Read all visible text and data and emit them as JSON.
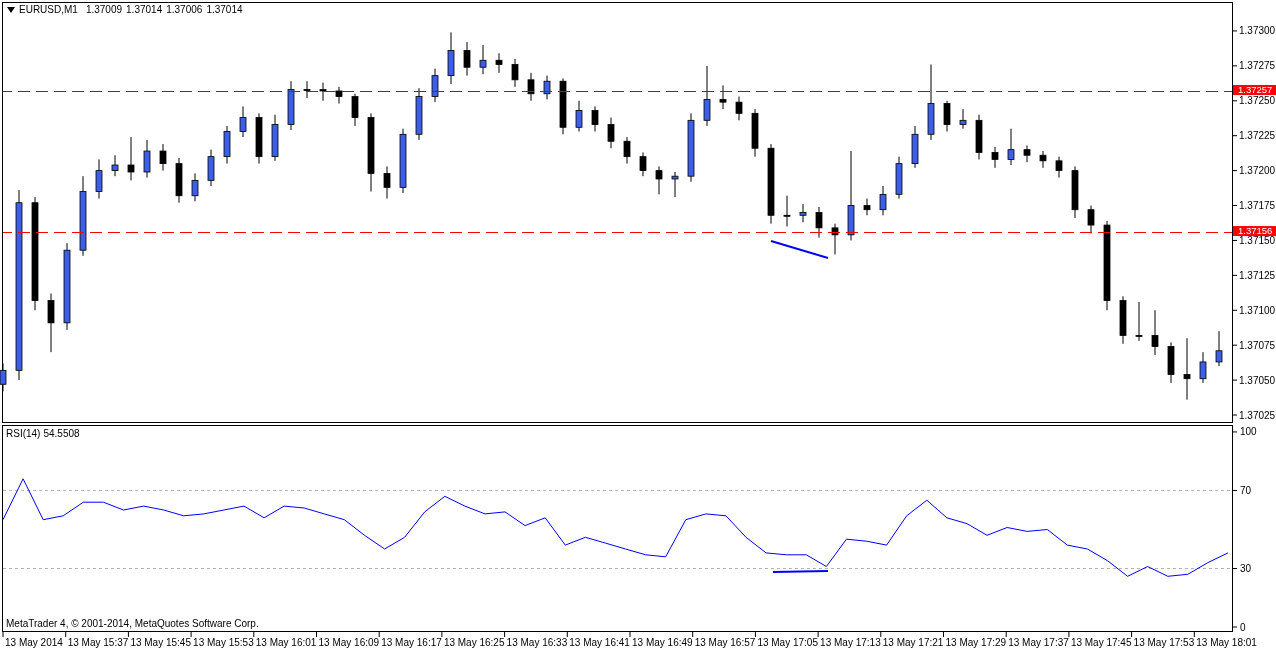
{
  "chart_header": {
    "symbol": "EURUSD,M1",
    "quotes": [
      "1.37009",
      "1.37014",
      "1.37006",
      "1.37014"
    ]
  },
  "horizontal_lines": [
    {
      "label": "1.37257",
      "color": "#404040"
    },
    {
      "label": "1.37156",
      "color": "#ff0000"
    }
  ],
  "price_chart": {
    "chart_data": {
      "type": "candlestick",
      "ylim": [
        1.3702,
        1.3732
      ],
      "yticks": [
        {
          "value": 1.373,
          "label": "1.37300"
        },
        {
          "value": 1.37275,
          "label": "1.37275"
        },
        {
          "value": 1.3725,
          "label": "1.37250"
        },
        {
          "value": 1.37225,
          "label": "1.37225"
        },
        {
          "value": 1.372,
          "label": "1.37200"
        },
        {
          "value": 1.37175,
          "label": "1.37175"
        },
        {
          "value": 1.3715,
          "label": "1.37150"
        },
        {
          "value": 1.37125,
          "label": "1.37125"
        },
        {
          "value": 1.371,
          "label": "1.37100"
        },
        {
          "value": 1.37075,
          "label": "1.37075"
        },
        {
          "value": 1.3705,
          "label": "1.37050"
        },
        {
          "value": 1.37025,
          "label": "1.37025"
        }
      ],
      "ohlc": [
        [
          1.37047,
          1.37062,
          1.37042,
          1.37057
        ],
        [
          1.37057,
          1.37186,
          1.3705,
          1.37177
        ],
        [
          1.37177,
          1.37181,
          1.371,
          1.37107
        ],
        [
          1.37107,
          1.37112,
          1.3707,
          1.37091
        ],
        [
          1.37091,
          1.37148,
          1.37086,
          1.37143
        ],
        [
          1.37143,
          1.37196,
          1.37139,
          1.37185
        ],
        [
          1.37185,
          1.37208,
          1.3718,
          1.372
        ],
        [
          1.372,
          1.37211,
          1.37196,
          1.37204
        ],
        [
          1.37204,
          1.37224,
          1.37193,
          1.37199
        ],
        [
          1.37199,
          1.37222,
          1.37195,
          1.37214
        ],
        [
          1.37214,
          1.37219,
          1.372,
          1.37205
        ],
        [
          1.37205,
          1.37209,
          1.37177,
          1.37182
        ],
        [
          1.37182,
          1.37198,
          1.37178,
          1.37193
        ],
        [
          1.37193,
          1.37215,
          1.37189,
          1.3721
        ],
        [
          1.3721,
          1.37232,
          1.37205,
          1.37228
        ],
        [
          1.37228,
          1.37246,
          1.37224,
          1.37238
        ],
        [
          1.37238,
          1.37241,
          1.37205,
          1.3721
        ],
        [
          1.3721,
          1.3724,
          1.37207,
          1.37233
        ],
        [
          1.37233,
          1.37264,
          1.37229,
          1.37258
        ],
        [
          1.37258,
          1.37264,
          1.37252,
          1.37258
        ],
        [
          1.37258,
          1.37263,
          1.3725,
          1.37257
        ],
        [
          1.37257,
          1.3726,
          1.37248,
          1.37253
        ],
        [
          1.37253,
          1.37255,
          1.37232,
          1.37238
        ],
        [
          1.37238,
          1.37241,
          1.37185,
          1.37198
        ],
        [
          1.37198,
          1.37203,
          1.3718,
          1.37188
        ],
        [
          1.37188,
          1.3723,
          1.37184,
          1.37226
        ],
        [
          1.37226,
          1.37259,
          1.37222,
          1.37253
        ],
        [
          1.37253,
          1.37273,
          1.37249,
          1.37268
        ],
        [
          1.37268,
          1.37299,
          1.37262,
          1.37286
        ],
        [
          1.37286,
          1.37292,
          1.37268,
          1.37274
        ],
        [
          1.37274,
          1.3729,
          1.37269,
          1.37279
        ],
        [
          1.37279,
          1.37284,
          1.3727,
          1.37276
        ],
        [
          1.37276,
          1.3728,
          1.3726,
          1.37265
        ],
        [
          1.37265,
          1.3727,
          1.3725,
          1.37255
        ],
        [
          1.37255,
          1.37268,
          1.37251,
          1.37264
        ],
        [
          1.37264,
          1.37266,
          1.37226,
          1.37231
        ],
        [
          1.37231,
          1.3725,
          1.37228,
          1.37243
        ],
        [
          1.37243,
          1.37246,
          1.37228,
          1.37233
        ],
        [
          1.37233,
          1.37238,
          1.37216,
          1.37221
        ],
        [
          1.37221,
          1.37224,
          1.37205,
          1.3721
        ],
        [
          1.3721,
          1.37213,
          1.37196,
          1.372
        ],
        [
          1.372,
          1.37203,
          1.37183,
          1.37194
        ],
        [
          1.37194,
          1.37199,
          1.37181,
          1.37196
        ],
        [
          1.37196,
          1.37241,
          1.37192,
          1.37236
        ],
        [
          1.37236,
          1.37275,
          1.37232,
          1.37251
        ],
        [
          1.37251,
          1.37261,
          1.37244,
          1.37249
        ],
        [
          1.37249,
          1.37253,
          1.37236,
          1.37241
        ],
        [
          1.37241,
          1.37244,
          1.3721,
          1.37216
        ],
        [
          1.37216,
          1.37219,
          1.37162,
          1.37168
        ],
        [
          1.37168,
          1.37182,
          1.3716,
          1.37168
        ],
        [
          1.37168,
          1.37176,
          1.37163,
          1.3717
        ],
        [
          1.3717,
          1.37174,
          1.37152,
          1.37159
        ],
        [
          1.37159,
          1.37162,
          1.3714,
          1.37154
        ],
        [
          1.37154,
          1.37214,
          1.3715,
          1.37175
        ],
        [
          1.37175,
          1.3718,
          1.37168,
          1.37172
        ],
        [
          1.37172,
          1.37189,
          1.37168,
          1.37183
        ],
        [
          1.37183,
          1.3721,
          1.3718,
          1.37205
        ],
        [
          1.37205,
          1.37232,
          1.37202,
          1.37226
        ],
        [
          1.37226,
          1.37276,
          1.37222,
          1.37248
        ],
        [
          1.37248,
          1.3725,
          1.37228,
          1.37233
        ],
        [
          1.37233,
          1.37244,
          1.3723,
          1.37236
        ],
        [
          1.37236,
          1.3724,
          1.37208,
          1.37213
        ],
        [
          1.37213,
          1.37217,
          1.37202,
          1.37208
        ],
        [
          1.37208,
          1.3723,
          1.37204,
          1.37215
        ],
        [
          1.37215,
          1.37218,
          1.37206,
          1.37211
        ],
        [
          1.37211,
          1.37214,
          1.37202,
          1.37207
        ],
        [
          1.37207,
          1.3721,
          1.37195,
          1.372
        ],
        [
          1.372,
          1.37203,
          1.37166,
          1.37172
        ],
        [
          1.37172,
          1.37175,
          1.37155,
          1.37161
        ],
        [
          1.37161,
          1.37164,
          1.371,
          1.37107
        ],
        [
          1.37107,
          1.3711,
          1.37076,
          1.37082
        ],
        [
          1.37082,
          1.37106,
          1.37078,
          1.37082
        ],
        [
          1.37082,
          1.371,
          1.37068,
          1.37074
        ],
        [
          1.37074,
          1.37077,
          1.37048,
          1.37054
        ],
        [
          1.37054,
          1.3708,
          1.37036,
          1.37051
        ],
        [
          1.37051,
          1.3707,
          1.37048,
          1.37063
        ],
        [
          1.37063,
          1.37085,
          1.3706,
          1.37071
        ]
      ]
    }
  },
  "indicator": {
    "reading": "54.5508",
    "chart_data": {
      "type": "line",
      "ylim": [
        -2.3,
        103.3
      ],
      "yticks": [
        {
          "value": 0,
          "label": "0"
        },
        {
          "value": 30,
          "label": "30"
        },
        {
          "value": 70,
          "label": "70"
        },
        {
          "value": 100,
          "label": "100"
        }
      ],
      "series": [
        {
          "name": "RSI(14)",
          "color": "#0000ff",
          "values": [
            55,
            76,
            55,
            57,
            64,
            64,
            60,
            62,
            60,
            57,
            58,
            60,
            62,
            56,
            62,
            61,
            58,
            55,
            47,
            40,
            46,
            59,
            67,
            62,
            58,
            59,
            52,
            56,
            42,
            46,
            43,
            40,
            37,
            36,
            55,
            58,
            57,
            46,
            38,
            37,
            37,
            31,
            45,
            44,
            42,
            57,
            65,
            56,
            53,
            47,
            51,
            49,
            50,
            42,
            40,
            34,
            26,
            31,
            26,
            27,
            33,
            38
          ]
        }
      ]
    }
  },
  "copyright": "MetaTrader 4, © 2001-2014, MetaQuotes Software Corp.",
  "time_axis": [
    "13 May 2014",
    "13 May 15:37",
    "13 May 15:45",
    "13 May 15:53",
    "13 May 16:01",
    "13 May 16:09",
    "13 May 16:17",
    "13 May 16:25",
    "13 May 16:33",
    "13 May 16:41",
    "13 May 16:49",
    "13 May 16:57",
    "13 May 17:05",
    "13 May 17:13",
    "13 May 17:21",
    "13 May 17:29",
    "13 May 17:37",
    "13 May 17:45",
    "13 May 17:53",
    "13 May 18:01"
  ]
}
